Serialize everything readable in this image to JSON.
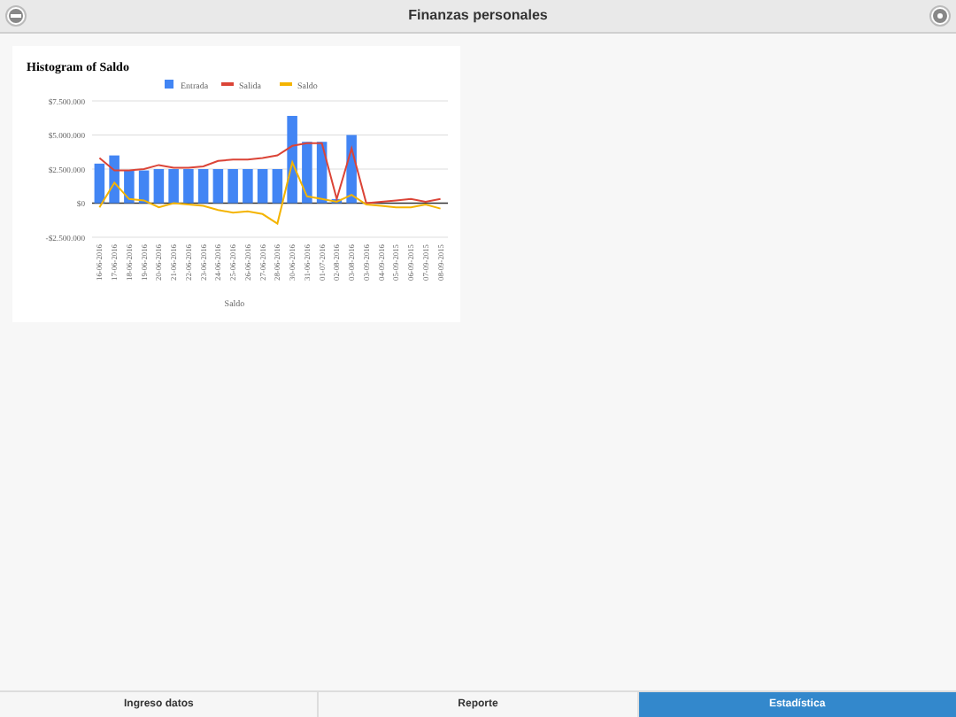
{
  "header": {
    "title": "Finanzas personales"
  },
  "chart": {
    "chart_data": {
      "type": "bar",
      "title": "Histogram of Saldo",
      "xlabel": "Saldo",
      "categories": [
        "16-06-2016",
        "17-06-2016",
        "18-06-2016",
        "19-06-2016",
        "20-06-2016",
        "21-06-2016",
        "22-06-2016",
        "23-06-2016",
        "24-06-2016",
        "25-06-2016",
        "26-06-2016",
        "27-06-2016",
        "28-06-2016",
        "30-06-2016",
        "31-06-2016",
        "01-07-2016",
        "02-08-2016",
        "03-08-2016",
        "03-09-2016",
        "04-09-2016",
        "05-09-2015",
        "06-09-2015",
        "07-09-2015",
        "08-09-2015"
      ],
      "series": [
        {
          "name": "Entrada",
          "color": "#4285f4",
          "values": [
            2900000,
            3500000,
            2400000,
            2400000,
            2500000,
            2500000,
            2500000,
            2500000,
            2500000,
            2500000,
            2500000,
            2500000,
            2500000,
            6400000,
            4500000,
            4500000,
            300000,
            5000000,
            0,
            0,
            0,
            0,
            0,
            0
          ]
        },
        {
          "name": "Salida",
          "color": "#db4437",
          "type": "line",
          "values": [
            3300000,
            2400000,
            2400000,
            2500000,
            2800000,
            2600000,
            2600000,
            2700000,
            3100000,
            3200000,
            3200000,
            3300000,
            3500000,
            4200000,
            4400000,
            4400000,
            300000,
            4000000,
            0,
            100000,
            200000,
            300000,
            100000,
            300000
          ]
        },
        {
          "name": "Saldo",
          "color": "#f4b400",
          "type": "line",
          "values": [
            -300000,
            1500000,
            300000,
            200000,
            -300000,
            0,
            -100000,
            -200000,
            -500000,
            -700000,
            -600000,
            -800000,
            -1500000,
            3000000,
            500000,
            300000,
            100000,
            600000,
            -100000,
            -200000,
            -300000,
            -300000,
            -100000,
            -400000
          ]
        }
      ],
      "legend": "top",
      "ylim": [
        -2500000,
        7500000
      ],
      "yticks": [
        {
          "value": -2500000,
          "label": "-$2.500.000"
        },
        {
          "value": 0,
          "label": "$0"
        },
        {
          "value": 2500000,
          "label": "$2.500.000"
        },
        {
          "value": 5000000,
          "label": "$5.000.000"
        },
        {
          "value": 7500000,
          "label": "$7.500.000"
        }
      ]
    }
  },
  "tabs": [
    {
      "label": "Ingreso datos",
      "selected": false
    },
    {
      "label": "Reporte",
      "selected": false
    },
    {
      "label": "Estadística",
      "selected": true
    }
  ]
}
